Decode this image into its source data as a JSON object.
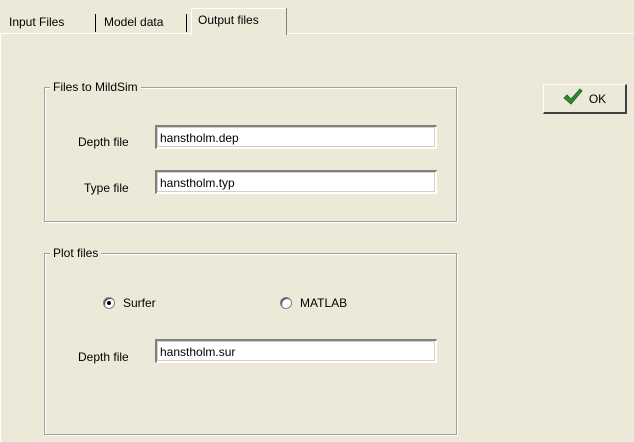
{
  "tabs": {
    "input_files": "Input Files",
    "model_data": "Model data",
    "output_files": "Output files"
  },
  "files_group": {
    "legend": "Files to MildSim",
    "depth_label": "Depth file",
    "depth_value": "hanstholm.dep",
    "type_label": "Type file",
    "type_value": "hanstholm.typ"
  },
  "plot_group": {
    "legend": "Plot files",
    "radio_surfer": "Surfer",
    "radio_matlab": "MATLAB",
    "selected": "Surfer",
    "depth_label": "Depth file",
    "depth_value": "hanstholm.sur"
  },
  "ok_button": {
    "label": "OK",
    "icon": "checkmark-icon",
    "icon_color": "#2E8B2E"
  }
}
